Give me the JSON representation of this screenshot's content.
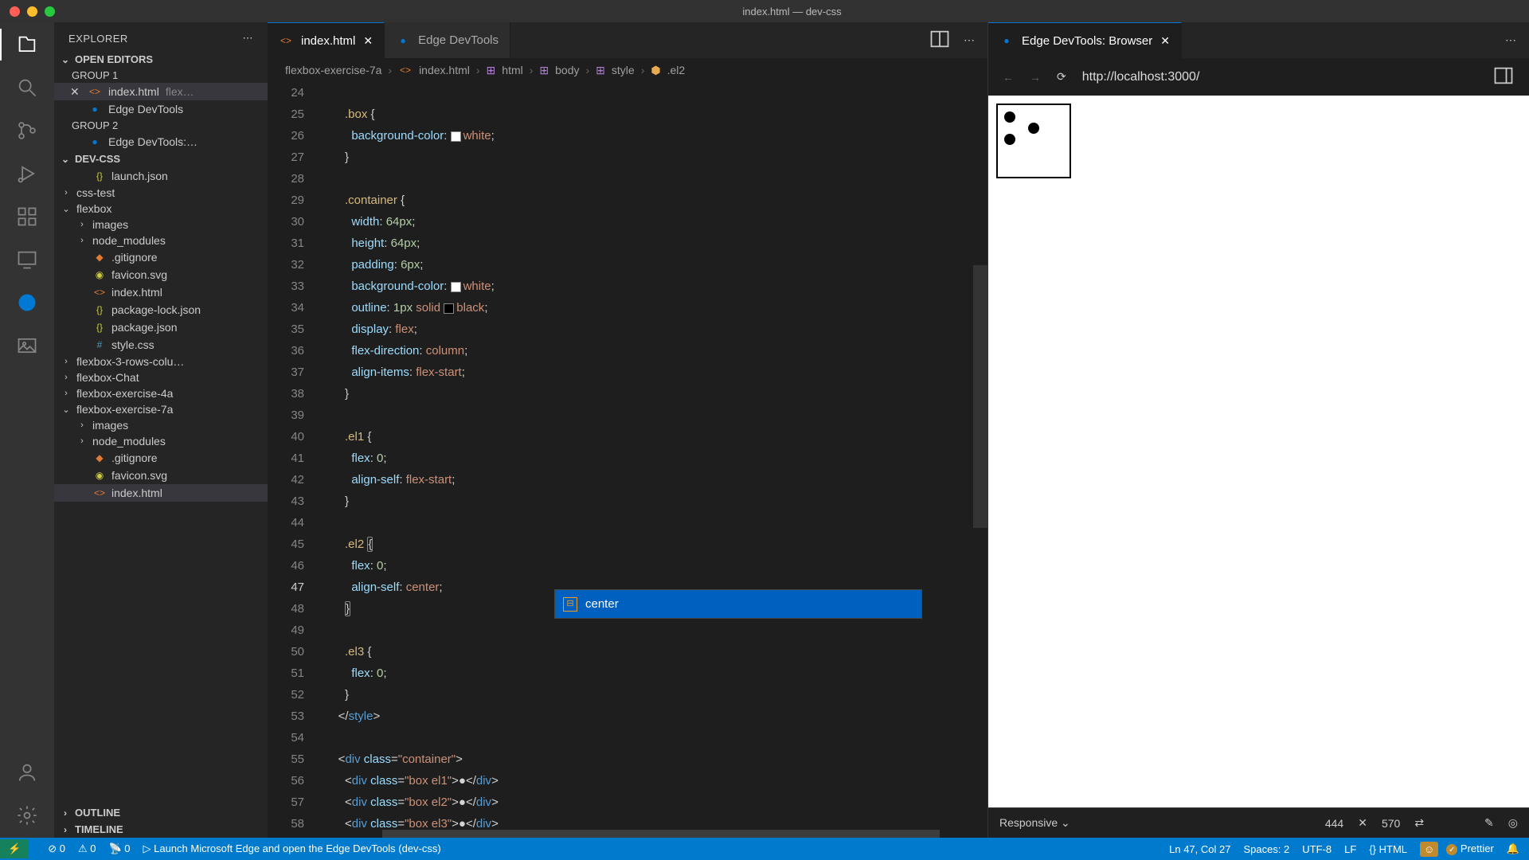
{
  "window": {
    "title": "index.html — dev-css"
  },
  "explorer": {
    "title": "EXPLORER",
    "sections": {
      "open_editors": "OPEN EDITORS",
      "group1": "GROUP 1",
      "group2": "GROUP 2",
      "workspace": "DEV-CSS",
      "outline": "OUTLINE",
      "timeline": "TIMELINE"
    },
    "open": {
      "file1": "index.html",
      "file1_hint": "flex…",
      "file2": "Edge DevTools",
      "file3": "Edge DevTools:…"
    },
    "tree": {
      "launch": "launch.json",
      "csstest": "css-test",
      "flexbox": "flexbox",
      "images": "images",
      "node_modules": "node_modules",
      "gitignore": ".gitignore",
      "favicon": "favicon.svg",
      "index": "index.html",
      "pkglock": "package-lock.json",
      "pkg": "package.json",
      "style": "style.css",
      "fb3": "flexbox-3-rows-colu…",
      "fbchat": "flexbox-Chat",
      "fb4a": "flexbox-exercise-4a",
      "fb7a": "flexbox-exercise-7a",
      "images2": "images",
      "nm2": "node_modules",
      "gitignore2": ".gitignore",
      "favicon2": "favicon.svg",
      "index2": "index.html"
    }
  },
  "tabs": {
    "t1": "index.html",
    "t2": "Edge DevTools"
  },
  "breadcrumb": {
    "p1": "flexbox-exercise-7a",
    "p2": "index.html",
    "p3": "html",
    "p4": "body",
    "p5": "style",
    "p6": ".el2"
  },
  "code": {
    "lines": [
      24,
      25,
      26,
      27,
      28,
      29,
      30,
      31,
      32,
      33,
      34,
      35,
      36,
      37,
      38,
      39,
      40,
      41,
      42,
      43,
      44,
      45,
      46,
      47,
      48,
      49,
      50,
      51,
      52,
      53,
      54,
      55,
      56,
      57,
      58
    ],
    "current_line": 47,
    "box_sel": ".box",
    "container_sel": ".container",
    "el1_sel": ".el1",
    "el2_sel": ".el2",
    "el3_sel": ".el3",
    "bgcolor": "background-color",
    "white": "white",
    "width": "width",
    "w_val": "64px",
    "height": "height",
    "h_val": "64px",
    "padding": "padding",
    "p_val": "6px",
    "outline": "outline",
    "o_px": "1px",
    "o_solid": "solid",
    "o_black": "black",
    "display": "display",
    "d_val": "flex",
    "flexdir": "flex-direction",
    "fd_val": "column",
    "alignitems": "align-items",
    "ai_val": "flex-start",
    "flex": "flex",
    "f_val": "0",
    "alignself": "align-self",
    "as_val1": "flex-start",
    "as_val2": "center",
    "endstyle": "style",
    "div": "div",
    "class": "class",
    "container_cls": "\"container\"",
    "box_el1": "\"box el1\"",
    "box_el2": "\"box el2\"",
    "box_el3": "\"box el3\""
  },
  "suggest": {
    "label": "center"
  },
  "right_tab": "Edge DevTools: Browser",
  "url": "http://localhost:3000/",
  "right_footer": {
    "responsive": "Responsive",
    "w": "444",
    "h": "570"
  },
  "statusbar": {
    "errors": "0",
    "warnings": "0",
    "ports": "0",
    "launch": "Launch Microsoft Edge and open the Edge DevTools (dev-css)",
    "pos": "Ln 47, Col 27",
    "spaces": "Spaces: 2",
    "encoding": "UTF-8",
    "eol": "LF",
    "lang": "HTML",
    "prettier": "Prettier"
  }
}
